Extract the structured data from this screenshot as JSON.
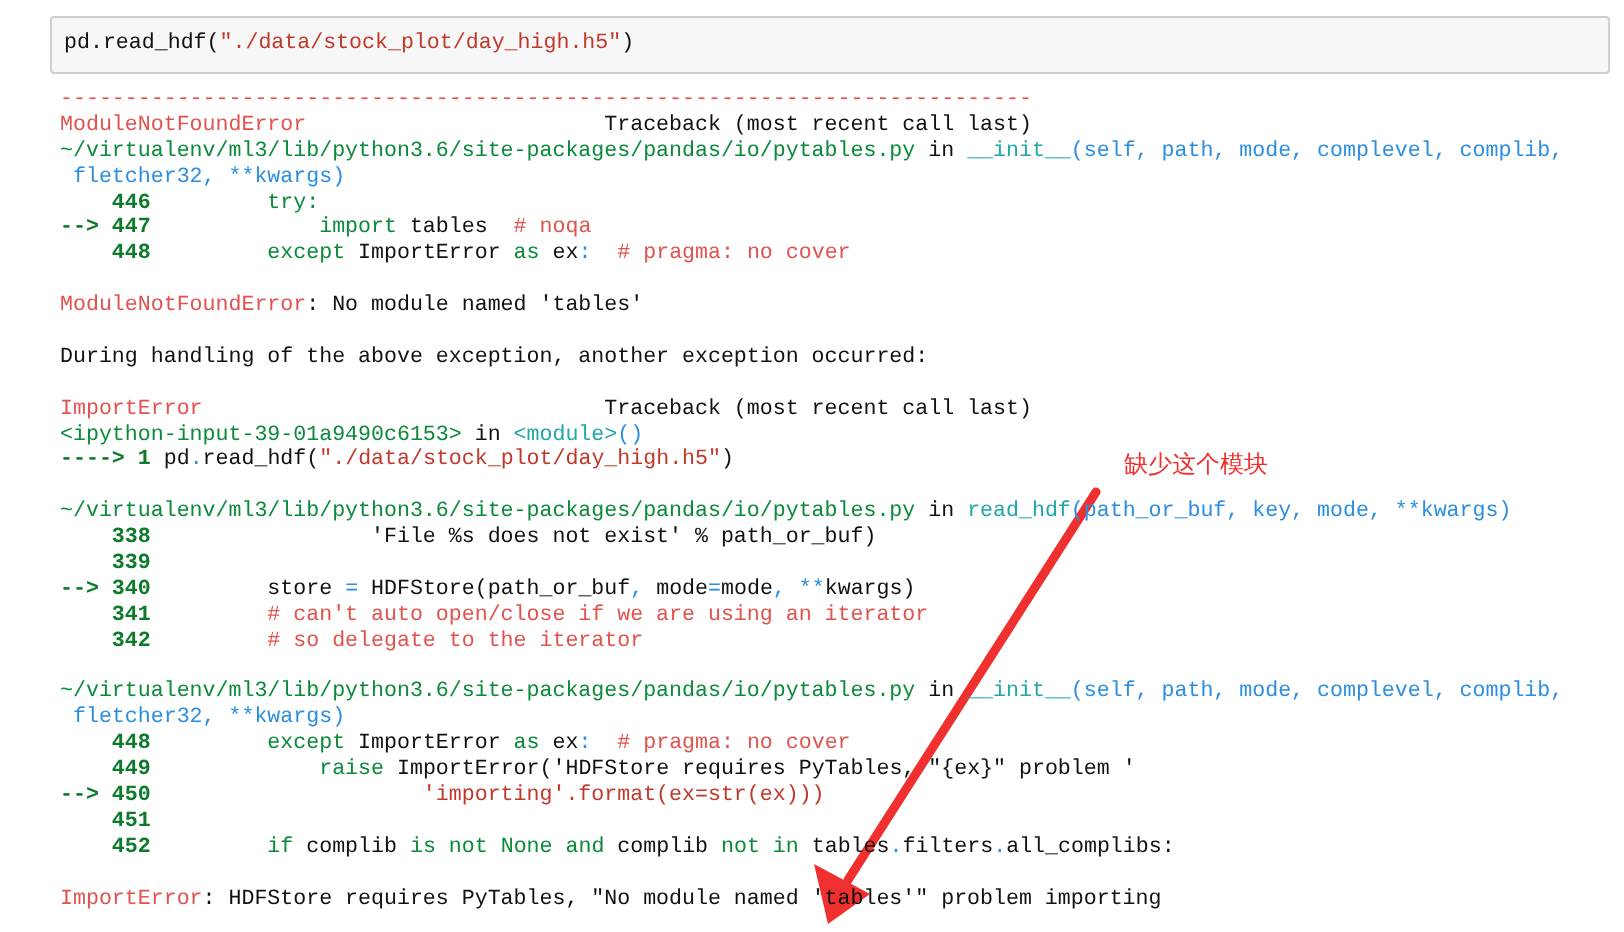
{
  "input_cell": {
    "segments": [
      {
        "text": "pd.read_hdf(",
        "kind": "plain"
      },
      {
        "text": "\"./data/stock_plot/day_high.h5\"",
        "kind": "string"
      },
      {
        "text": ")",
        "kind": "plain"
      }
    ]
  },
  "output_blocks": [
    [
      {
        "segments": [
          {
            "text": "---------------------------------------------------------------------------",
            "kind": "error"
          }
        ]
      },
      {
        "segments": [
          {
            "text": "ModuleNotFoundError",
            "kind": "error"
          },
          {
            "text": "                       Traceback (most recent call last)",
            "kind": "plain"
          }
        ]
      },
      {
        "segments": [
          {
            "text": "~/virtualenv/ml3/lib/python3.6/site-packages/pandas/io/pytables.py",
            "kind": "path"
          },
          {
            "text": " in ",
            "kind": "plain"
          },
          {
            "text": "__init__",
            "kind": "func"
          },
          {
            "text": "(self, path, mode, complevel, complib,",
            "kind": "args"
          }
        ]
      },
      {
        "segments": [
          {
            "text": " fletcher32, **kwargs)",
            "kind": "args"
          }
        ]
      },
      {
        "segments": [
          {
            "text": "    446",
            "kind": "lineno"
          },
          {
            "text": "         try:",
            "kind": "keyword"
          }
        ]
      },
      {
        "segments": [
          {
            "text": "--> 447",
            "kind": "lineno"
          },
          {
            "text": "             import",
            "kind": "keyword"
          },
          {
            "text": " tables  ",
            "kind": "plain"
          },
          {
            "text": "# noqa",
            "kind": "comment"
          }
        ]
      },
      {
        "segments": [
          {
            "text": "    448",
            "kind": "lineno"
          },
          {
            "text": "         except",
            "kind": "keyword"
          },
          {
            "text": " ImportError ",
            "kind": "plain"
          },
          {
            "text": "as",
            "kind": "keyword"
          },
          {
            "text": " ex",
            "kind": "plain"
          },
          {
            "text": ":",
            "kind": "op"
          },
          {
            "text": "  # pragma: no cover",
            "kind": "comment"
          }
        ]
      }
    ],
    [
      {
        "segments": [
          {
            "text": "ModuleNotFoundError",
            "kind": "error"
          },
          {
            "text": ": No module named 'tables'",
            "kind": "plain"
          }
        ]
      }
    ],
    [
      {
        "segments": [
          {
            "text": "During handling of the above exception, another exception occurred:",
            "kind": "plain"
          }
        ]
      }
    ],
    [
      {
        "segments": [
          {
            "text": "ImportError",
            "kind": "error"
          },
          {
            "text": "                               Traceback (most recent call last)",
            "kind": "plain"
          }
        ]
      },
      {
        "segments": [
          {
            "text": "<ipython-input-39-01a9490c6153>",
            "kind": "path"
          },
          {
            "text": " in ",
            "kind": "plain"
          },
          {
            "text": "<module>",
            "kind": "func"
          },
          {
            "text": "()",
            "kind": "args"
          }
        ]
      },
      {
        "segments": [
          {
            "text": "----> 1",
            "kind": "lineno"
          },
          {
            "text": " pd",
            "kind": "plain"
          },
          {
            "text": ".",
            "kind": "op"
          },
          {
            "text": "read_hdf(",
            "kind": "plain"
          },
          {
            "text": "\"./data/stock_plot/day_high.h5\"",
            "kind": "string"
          },
          {
            "text": ")",
            "kind": "plain"
          }
        ]
      }
    ],
    [
      {
        "segments": [
          {
            "text": "~/virtualenv/ml3/lib/python3.6/site-packages/pandas/io/pytables.py",
            "kind": "path"
          },
          {
            "text": " in ",
            "kind": "plain"
          },
          {
            "text": "read_hdf",
            "kind": "func"
          },
          {
            "text": "(path_or_buf, key, mode, **kwargs)",
            "kind": "args"
          }
        ]
      },
      {
        "segments": [
          {
            "text": "    338",
            "kind": "lineno"
          },
          {
            "text": "                 'File %s does not exist' % path_or_buf)",
            "kind": "plain"
          }
        ]
      },
      {
        "segments": [
          {
            "text": "    339",
            "kind": "lineno"
          }
        ]
      },
      {
        "segments": [
          {
            "text": "--> 340",
            "kind": "lineno"
          },
          {
            "text": "         store ",
            "kind": "plain"
          },
          {
            "text": "=",
            "kind": "op"
          },
          {
            "text": " HDFStore(path_or_buf",
            "kind": "plain"
          },
          {
            "text": ",",
            "kind": "op"
          },
          {
            "text": " mode",
            "kind": "plain"
          },
          {
            "text": "=",
            "kind": "op"
          },
          {
            "text": "mode",
            "kind": "plain"
          },
          {
            "text": ",",
            "kind": "op"
          },
          {
            "text": " **",
            "kind": "op"
          },
          {
            "text": "kwargs)",
            "kind": "plain"
          }
        ]
      },
      {
        "segments": [
          {
            "text": "    341",
            "kind": "lineno"
          },
          {
            "text": "         # can't auto open/close if we are using an iterator",
            "kind": "comment"
          }
        ]
      },
      {
        "segments": [
          {
            "text": "    342",
            "kind": "lineno"
          },
          {
            "text": "         # so delegate to the iterator",
            "kind": "comment"
          }
        ]
      }
    ],
    [
      {
        "segments": [
          {
            "text": "~/virtualenv/ml3/lib/python3.6/site-packages/pandas/io/pytables.py",
            "kind": "path"
          },
          {
            "text": " in ",
            "kind": "plain"
          },
          {
            "text": "__init__",
            "kind": "func"
          },
          {
            "text": "(self, path, mode, complevel, complib,",
            "kind": "args"
          }
        ]
      },
      {
        "segments": [
          {
            "text": " fletcher32, **kwargs)",
            "kind": "args"
          }
        ]
      },
      {
        "segments": [
          {
            "text": "    448",
            "kind": "lineno"
          },
          {
            "text": "         except",
            "kind": "keyword"
          },
          {
            "text": " ImportError ",
            "kind": "plain"
          },
          {
            "text": "as",
            "kind": "keyword"
          },
          {
            "text": " ex",
            "kind": "plain"
          },
          {
            "text": ":",
            "kind": "op"
          },
          {
            "text": "  # pragma: no cover",
            "kind": "comment"
          }
        ]
      },
      {
        "segments": [
          {
            "text": "    449",
            "kind": "lineno"
          },
          {
            "text": "             raise",
            "kind": "keyword"
          },
          {
            "text": " ImportError('HDFStore requires PyTables, \"{ex}\" problem '",
            "kind": "plain"
          }
        ]
      },
      {
        "segments": [
          {
            "text": "--> 450",
            "kind": "lineno"
          },
          {
            "text": "                     'importing'.format(ex=str(ex)))",
            "kind": "string"
          }
        ]
      },
      {
        "segments": [
          {
            "text": "    451",
            "kind": "lineno"
          }
        ]
      },
      {
        "segments": [
          {
            "text": "    452",
            "kind": "lineno"
          },
          {
            "text": "         if",
            "kind": "keyword"
          },
          {
            "text": " complib ",
            "kind": "plain"
          },
          {
            "text": "is not",
            "kind": "keyword"
          },
          {
            "text": " None",
            "kind": "keyword"
          },
          {
            "text": " and",
            "kind": "keyword"
          },
          {
            "text": " complib ",
            "kind": "plain"
          },
          {
            "text": "not in",
            "kind": "keyword"
          },
          {
            "text": " tables",
            "kind": "plain"
          },
          {
            "text": ".",
            "kind": "op"
          },
          {
            "text": "filters",
            "kind": "plain"
          },
          {
            "text": ".",
            "kind": "op"
          },
          {
            "text": "all_complibs:",
            "kind": "plain"
          }
        ]
      }
    ],
    [
      {
        "segments": [
          {
            "text": "ImportError",
            "kind": "error"
          },
          {
            "text": ": HDFStore requires PyTables, \"No module named 'tables'\" problem importing",
            "kind": "plain"
          }
        ]
      }
    ]
  ],
  "annotation": {
    "text": "缺少这个模块"
  }
}
